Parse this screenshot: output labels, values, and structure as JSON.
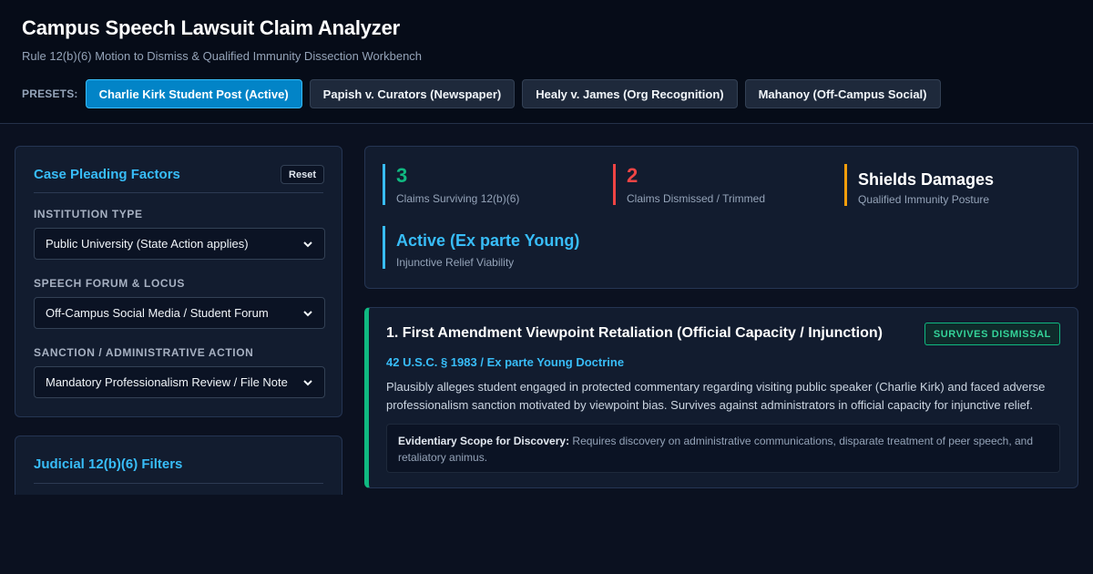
{
  "header": {
    "title": "Campus Speech Lawsuit Claim Analyzer",
    "subtitle": "Rule 12(b)(6) Motion to Dismiss & Qualified Immunity Dissection Workbench",
    "presets_label": "PRESETS:",
    "presets": [
      {
        "label": "Charlie Kirk Student Post (Active)",
        "active": true
      },
      {
        "label": "Papish v. Curators (Newspaper)",
        "active": false
      },
      {
        "label": "Healy v. James (Org Recognition)",
        "active": false
      },
      {
        "label": "Mahanoy (Off-Campus Social)",
        "active": false
      }
    ]
  },
  "factors": {
    "title": "Case Pleading Factors",
    "reset_label": "Reset",
    "institution_label": "INSTITUTION TYPE",
    "institution_value": "Public University (State Action applies)",
    "forum_label": "SPEECH FORUM & LOCUS",
    "forum_value": "Off-Campus Social Media / Student Forum",
    "sanction_label": "SANCTION / ADMINISTRATIVE ACTION",
    "sanction_value": "Mandatory Professionalism Review / File Note"
  },
  "filters": {
    "title": "Judicial 12(b)(6) Filters"
  },
  "summary": {
    "surviving_value": "3",
    "surviving_label": "Claims Surviving 12(b)(6)",
    "dismissed_value": "2",
    "dismissed_label": "Claims Dismissed / Trimmed",
    "qi_value": "Shields Damages",
    "qi_label": "Qualified Immunity Posture",
    "injunctive_value": "Active (Ex parte Young)",
    "injunctive_label": "Injunctive Relief Viability"
  },
  "colors": {
    "surviving": "#10b981",
    "dismissed": "#ef4444",
    "qi": "#f59e0b",
    "accent": "#38bdf8"
  },
  "claims": [
    {
      "title": "1. First Amendment Viewpoint Retaliation (Official Capacity / Injunction)",
      "status": "SURVIVES DISMISSAL",
      "statute": "42 U.S.C. § 1983 / Ex parte Young Doctrine",
      "description": "Plausibly alleges student engaged in protected commentary regarding visiting public speaker (Charlie Kirk) and faced adverse professionalism sanction motivated by viewpoint bias. Survives against administrators in official capacity for injunctive relief.",
      "evidence_label": "Evidentiary Scope for Discovery:",
      "evidence_text": "Requires discovery on administrative communications, disparate treatment of peer speech, and retaliatory animus."
    }
  ]
}
